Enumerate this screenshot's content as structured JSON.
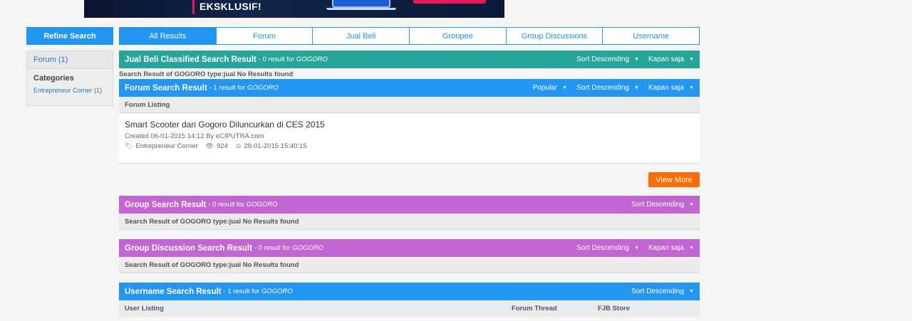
{
  "banner": {
    "text": "EKSKLUSIF!"
  },
  "sidebar": {
    "refine_label": "Refine Search",
    "forum_filter": "Forum (1)",
    "categories_title": "Categories",
    "category_item": "Entrepreneur Corner",
    "category_count": "(1)"
  },
  "tabs": [
    {
      "label": "All Results",
      "active": true
    },
    {
      "label": "Forum"
    },
    {
      "label": "Jual Beli"
    },
    {
      "label": "Groupee"
    },
    {
      "label": "Group Discussions"
    },
    {
      "label": "Username"
    }
  ],
  "query": "GOGORO",
  "jualbeli": {
    "title": "Jual Beli Classified Search Result",
    "count_text": "- 0 result for",
    "sort": "Sort Descending",
    "time": "Kapan saja",
    "no_results": "Search Result of GOGORO type:jual No Results found"
  },
  "forum": {
    "title": "Forum Search Result",
    "count_text": "- 1 result for",
    "popular": "Popular",
    "sort": "Sort Descending",
    "time": "Kapan saja",
    "listing_label": "Forum Listing",
    "thread": {
      "title": "Smart Scooter dari Gogoro Diluncurkan di CES 2015",
      "meta": "Created 06-01-2015 14:12 By eCIPUTRA.com",
      "category": "Entrepreneur Corner",
      "views": "924",
      "last_updated": "28-01-2015 15:40:15"
    },
    "view_more": "View More"
  },
  "group": {
    "title": "Group Search Result",
    "count_text": "- 0 result for",
    "sort": "Sort Descending",
    "no_results": "Search Result of GOGORO type:jual No Results found"
  },
  "group_discussion": {
    "title": "Group Discussion Search Result",
    "count_text": "- 0 result for",
    "sort": "Sort Descending",
    "time": "Kapan saja",
    "no_results": "Search Result of GOGORO type:jual No Results found"
  },
  "username": {
    "title": "Username Search Result",
    "count_text": "- 1 result for",
    "sort": "Sort Descending",
    "columns": [
      "User Listing",
      "Forum Thread",
      "FJB Store"
    ]
  },
  "colors": {
    "primary": "#2196f3",
    "teal": "#26a69a",
    "purple": "#c264d2",
    "orange": "#ff6d00"
  }
}
